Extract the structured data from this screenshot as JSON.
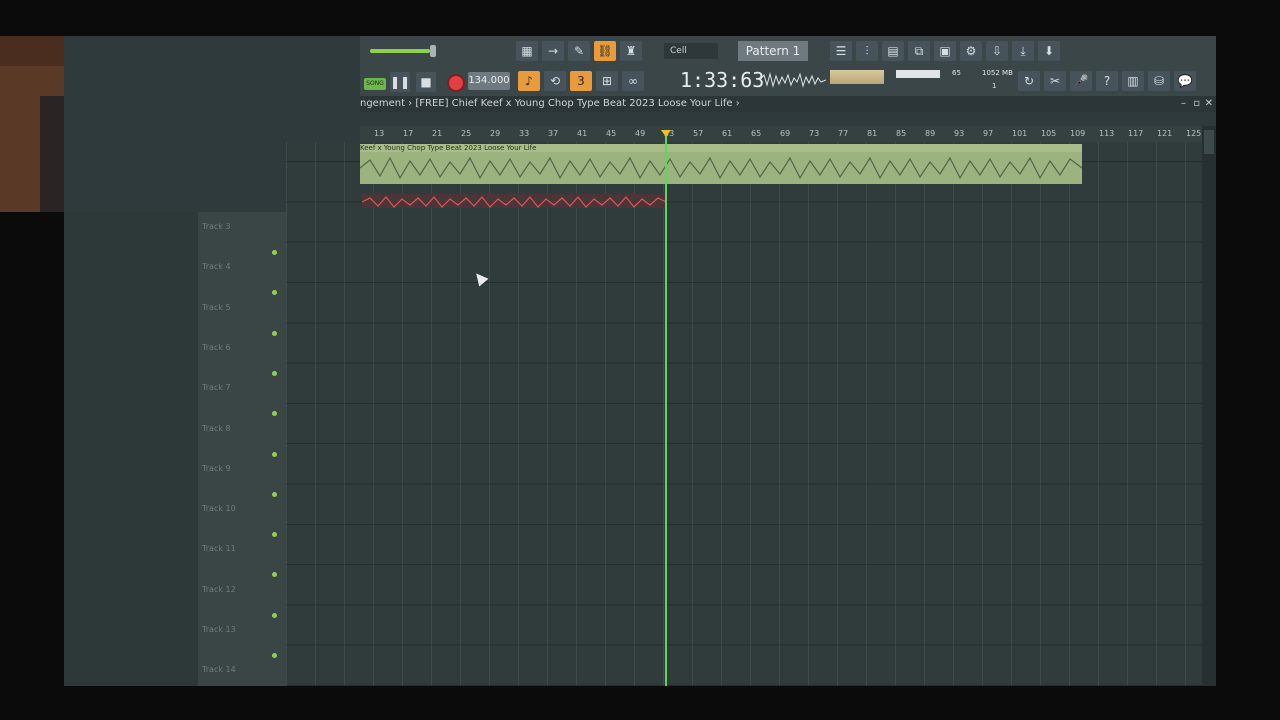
{
  "toolbar": {
    "snap_label": "Cell",
    "pattern_label": "Pattern 1",
    "song_mode_label": "SONG",
    "tempo": "134.000",
    "time_display": "1:33:63",
    "cpu_value": "65",
    "memory": "1052 MB",
    "voices": "1",
    "icons": [
      "piano-icon",
      "arrow-icon",
      "pencil-icon",
      "link-icon",
      "stamp-icon",
      "playlist-icon",
      "mixer-icon",
      "channel-rack-icon",
      "browser-icon",
      "plugin-icon",
      "cpu-icon",
      "mic-icon",
      "help-icon",
      "save-icon",
      "export-icon",
      "chat-icon"
    ]
  },
  "titlebar": {
    "breadcrumb": "ngement › [FREE] Chief Keef x Young Chop Type Beat 2023 Loose Your Life ›"
  },
  "ruler": {
    "marks": [
      "13",
      "17",
      "21",
      "25",
      "29",
      "33",
      "37",
      "41",
      "45",
      "49",
      "53",
      "57",
      "61",
      "65",
      "69",
      "73",
      "77",
      "81",
      "85",
      "89",
      "93",
      "97",
      "101",
      "105",
      "109",
      "113",
      "117",
      "121",
      "125"
    ]
  },
  "clips": {
    "audio_label": "Keef x Young Chop Type Beat 2023 Loose Your Life"
  },
  "tracks": [
    {
      "name": "Track 3"
    },
    {
      "name": "Track 4"
    },
    {
      "name": "Track 5"
    },
    {
      "name": "Track 6"
    },
    {
      "name": "Track 7"
    },
    {
      "name": "Track 8"
    },
    {
      "name": "Track 9"
    },
    {
      "name": "Track 10"
    },
    {
      "name": "Track 11"
    },
    {
      "name": "Track 12"
    },
    {
      "name": "Track 13"
    },
    {
      "name": "Track 14"
    }
  ],
  "colors": {
    "accent_orange": "#e99a3a",
    "playhead_green": "#5dd65b",
    "audio_clip": "#9db37f",
    "record_red": "#e24040"
  }
}
